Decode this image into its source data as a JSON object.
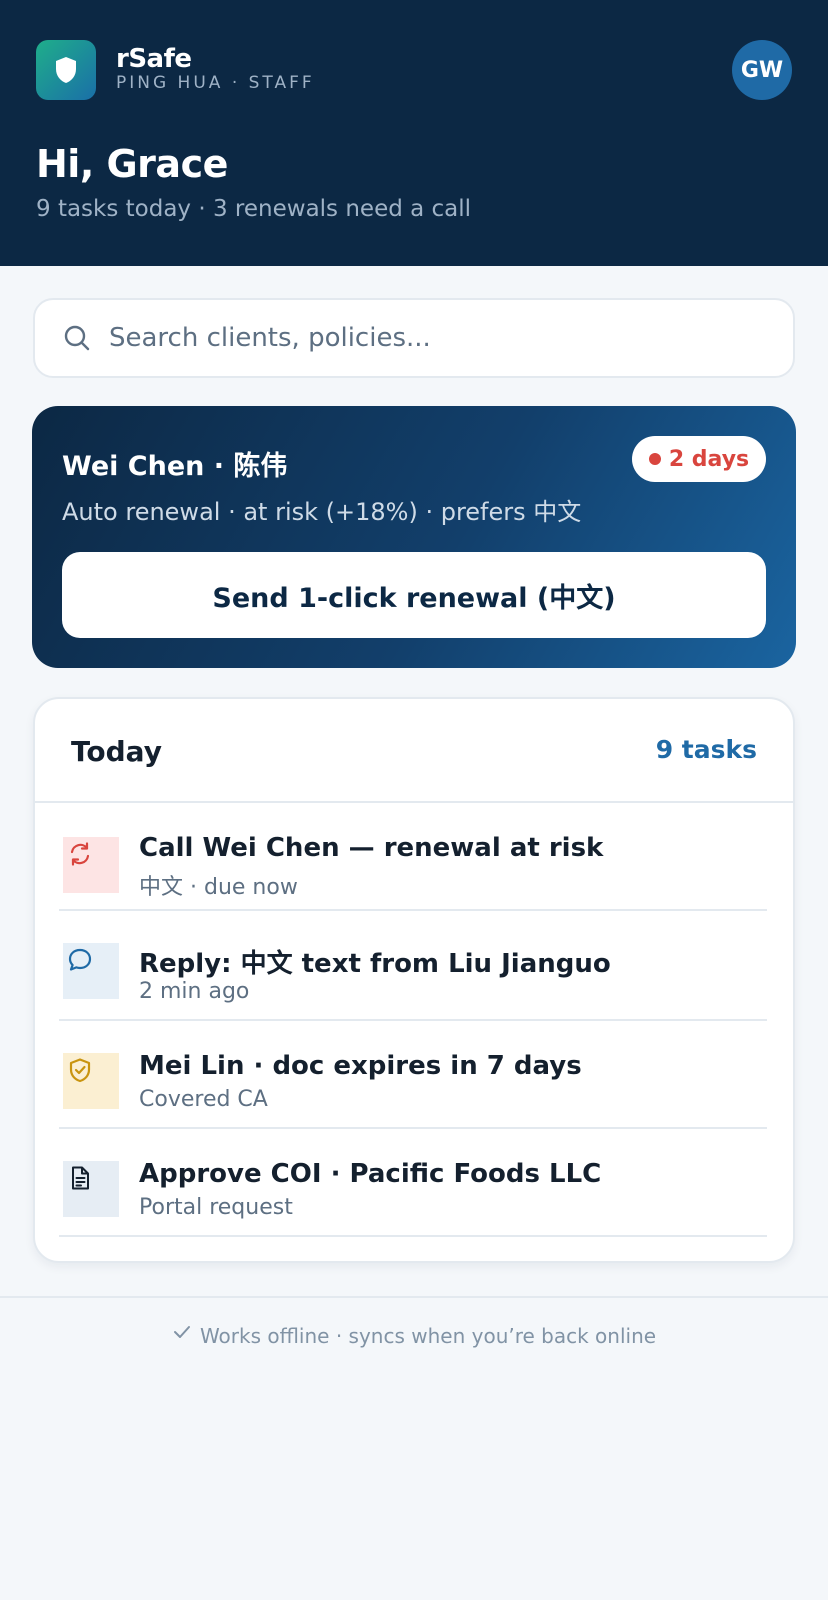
{
  "brand": {
    "name": "rSafe",
    "subtitle": "PING HUA · STAFF",
    "accent": "#1fae8a"
  },
  "user": {
    "initials": "GW",
    "greeting": "Hi, Grace",
    "summary": "9 tasks today · 3 renewals need a call"
  },
  "search": {
    "placeholder": "Search clients, policies...",
    "value": ""
  },
  "alert": {
    "client": "Wei Chen · 陈伟",
    "badge": "2 days",
    "detail": "Auto renewal · at risk (+18%) · prefers 中文",
    "action": "Send 1-click renewal (中文)",
    "badge_color": "#d9453e"
  },
  "today": {
    "title": "Today",
    "count_label": "9 tasks",
    "tasks": [
      {
        "title": "Call Wei Chen — renewal at risk",
        "sub": "中文 · due now",
        "icon": "refresh-icon",
        "tint": "#fde4e4"
      },
      {
        "title": "Reply: 中文 text from Liu Jianguo",
        "sub": "2 min ago",
        "icon": "chat-bubble-icon",
        "tint": "#e6eff7"
      },
      {
        "title": "Mei Lin · doc expires in 7 days",
        "sub": "Covered CA",
        "icon": "shield-check-icon",
        "tint": "#fbefd2"
      },
      {
        "title": "Approve COI · Pacific Foods LLC",
        "sub": "Portal request",
        "icon": "document-icon",
        "tint": "#e6edf4"
      }
    ]
  },
  "footer": {
    "text": "Works offline · syncs when you’re back online"
  }
}
